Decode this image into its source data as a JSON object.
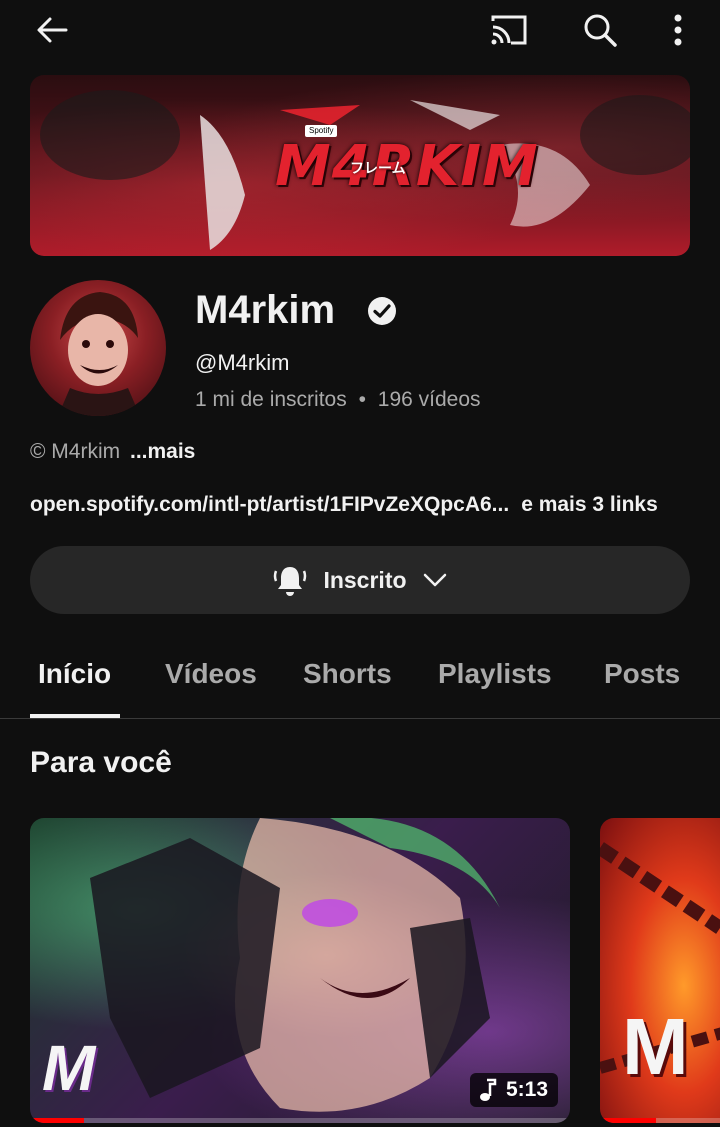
{
  "header": {
    "icons": [
      "back-arrow-icon",
      "cast-icon",
      "search-icon",
      "more-vert-icon"
    ]
  },
  "banner": {
    "logo_text": "M4RKIM",
    "sub_text": "フレーム",
    "badge_text": "Spotify"
  },
  "channel": {
    "name": "M4rkim",
    "handle": "@M4rkim",
    "subscribers": "1 mi de inscritos",
    "dot": "•",
    "videos": "196 vídeos",
    "description": "© M4rkim",
    "more_label": "...mais",
    "link_url": "open.spotify.com/intl-pt/artist/1FIPvZeXQpcA6...",
    "more_links": "e mais 3 links"
  },
  "subscribe": {
    "label": "Inscrito",
    "icons": [
      "bell-icon",
      "chevron-down-icon"
    ]
  },
  "tabs": [
    {
      "label": "Início",
      "active": true
    },
    {
      "label": "Vídeos",
      "active": false
    },
    {
      "label": "Shorts",
      "active": false
    },
    {
      "label": "Playlists",
      "active": false
    },
    {
      "label": "Posts",
      "active": false
    }
  ],
  "section": {
    "title": "Para você"
  },
  "videos": [
    {
      "duration": "5:13",
      "thumb_text": "M",
      "progress_pct": 10
    },
    {
      "thumb_text": "M",
      "progress_pct": 40
    }
  ],
  "colors": {
    "background": "#0f0f0f",
    "text_primary": "#f1f1f1",
    "text_secondary": "#aaaaaa",
    "button_bg": "#272727",
    "progress": "#ff0000"
  }
}
